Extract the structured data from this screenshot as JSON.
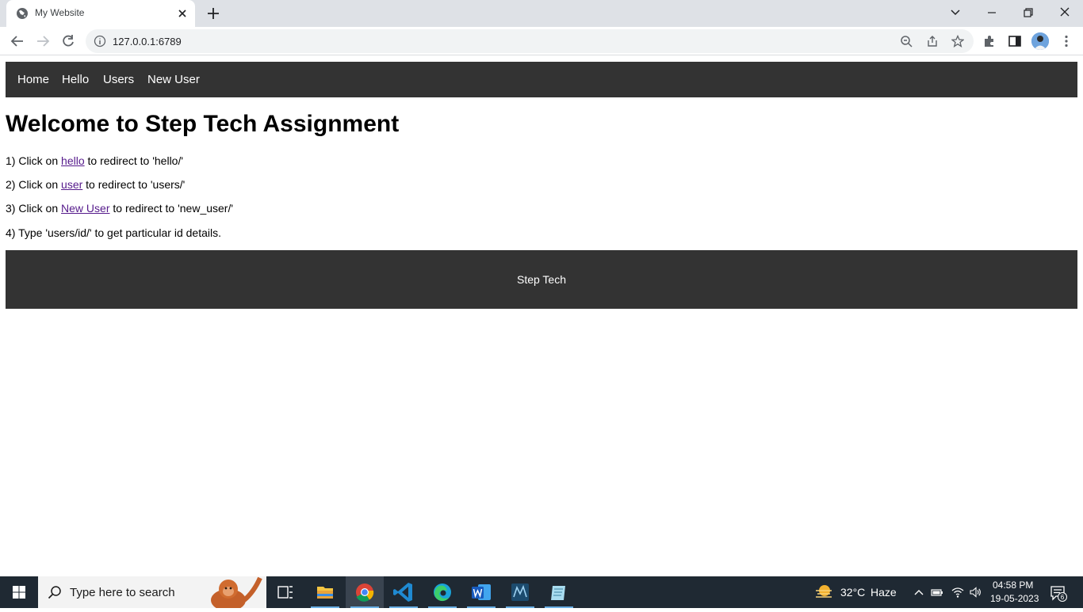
{
  "browser": {
    "tab_title": "My Website",
    "url": "127.0.0.1:6789"
  },
  "nav": {
    "items": [
      "Home",
      "Hello",
      "Users",
      "New User"
    ]
  },
  "main": {
    "heading": "Welcome to Step Tech Assignment",
    "lines": [
      {
        "prefix": "1) Click on ",
        "link": "hello",
        "suffix": " to redirect to 'hello/'"
      },
      {
        "prefix": "2) Click on ",
        "link": "user",
        "suffix": " to redirect to 'users/'"
      },
      {
        "prefix": "3) Click on ",
        "link": "New User",
        "suffix": " to redirect to 'new_user/'"
      },
      {
        "prefix": "4) Type 'users/id/' to get particular id details.",
        "link": "",
        "suffix": ""
      }
    ]
  },
  "footer": {
    "text": "Step Tech"
  },
  "taskbar": {
    "search_placeholder": "Type here to search",
    "apps": [
      "task-view-icon",
      "file-explorer-icon",
      "chrome-icon",
      "vscode-icon",
      "edge-icon",
      "word-icon",
      "mysql-workbench-icon",
      "notepad-icon"
    ],
    "weather_temp": "32°C",
    "weather_desc": "Haze",
    "time": "04:58 PM",
    "date": "19-05-2023",
    "notification_count": "6"
  },
  "colors": {
    "nav_bg": "#333333",
    "link_visited": "#551a8b",
    "taskbar_bg": "#1f2933"
  }
}
